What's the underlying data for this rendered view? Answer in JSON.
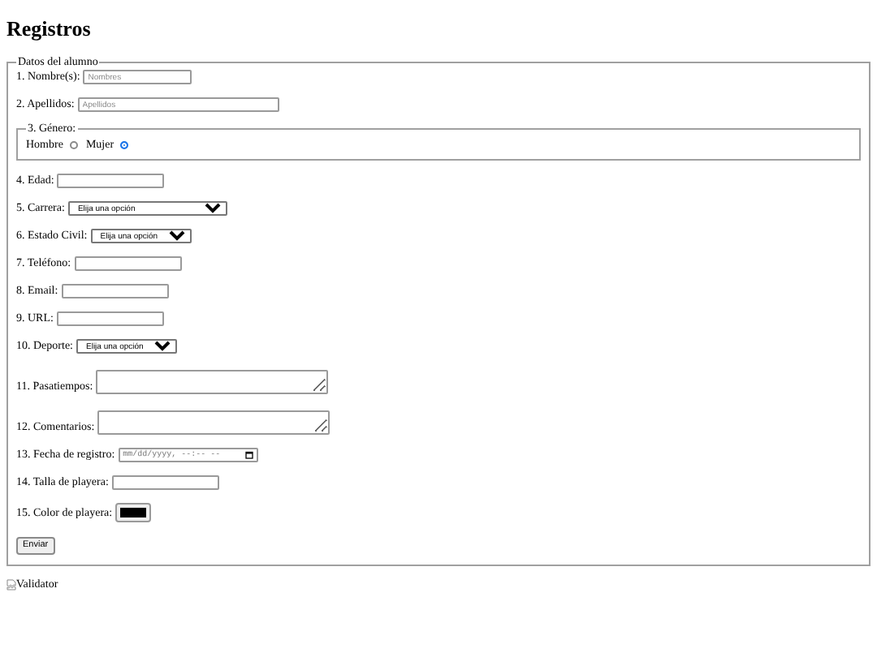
{
  "title": "Registros",
  "form": {
    "legend": "Datos del alumno",
    "fields": [
      {
        "kind": "text",
        "label": "1. Nombre(s):",
        "placeholder": "Nombres"
      },
      {
        "kind": "text",
        "label": "2. Apellidos:",
        "placeholder": "Apellidos"
      },
      {
        "kind": "radio",
        "legend": "3. Género:",
        "options": [
          {
            "label": "Hombre",
            "selected": false
          },
          {
            "label": "Mujer",
            "selected": true
          }
        ]
      },
      {
        "kind": "text",
        "label": "4. Edad:"
      },
      {
        "kind": "select",
        "label": "5. Carrera:",
        "value": "Elija una opción"
      },
      {
        "kind": "select",
        "label": "6. Estado Civil:",
        "value": "Elija una opción"
      },
      {
        "kind": "text",
        "label": "7. Teléfono:"
      },
      {
        "kind": "text",
        "label": "8. Email:"
      },
      {
        "kind": "text",
        "label": "9. URL:"
      },
      {
        "kind": "select",
        "label": "10. Deporte:",
        "value": "Elija una opción"
      },
      {
        "kind": "textarea",
        "label": "11. Pasatiempos:"
      },
      {
        "kind": "textarea",
        "label": "12. Comentarios:"
      },
      {
        "kind": "datetime",
        "label": "13. Fecha de registro:",
        "placeholder": "mm/dd/yyyy, --:-- --"
      },
      {
        "kind": "text",
        "label": "14. Talla de playera:"
      },
      {
        "kind": "color",
        "label": "15. Color de playera:",
        "color": "#000000"
      }
    ],
    "submit": "Enviar"
  },
  "image_alt": "Validator"
}
